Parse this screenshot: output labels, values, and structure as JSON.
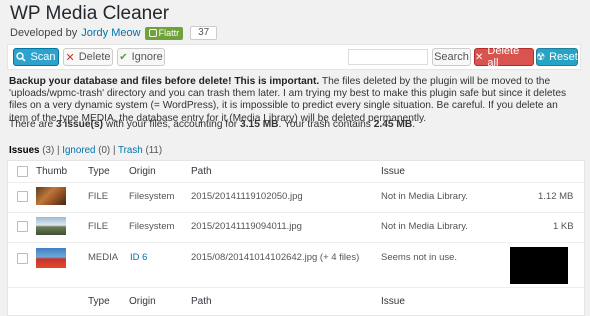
{
  "page": {
    "title": "WP Media Cleaner",
    "developed_by": "Developed by",
    "author": "Jordy Meow",
    "flattr_label": "Flattr",
    "flattr_count": "37"
  },
  "toolbar": {
    "scan_label": "Scan",
    "delete_label": "Delete",
    "ignore_label": "Ignore",
    "search_placeholder": "",
    "search_label": "Search",
    "delete_all_label": "Delete all",
    "reset_label": "Reset"
  },
  "notice": {
    "strong": "Backup your database and files before delete! This is important.",
    "text": " The files deleted by the plugin will be moved to the 'uploads/wpmc-trash' directory and you can trash them later. I am trying my best to make this plugin safe but since it deletes files on a very dynamic system (= WordPress), it is impossible to predict every single situation. Be careful. If you delete an item of the type MEDIA, the database entry for it (Media Library) will be deleted permanently."
  },
  "summary": {
    "prefix": "There are ",
    "issues": "3 issue(s)",
    "middle": " with your files, accounting for ",
    "size": "3.15 MB",
    "trash_text": ". Your trash contains ",
    "trash_size": "2.45 MB",
    "suffix": "."
  },
  "filters": {
    "issues_label": "Issues",
    "issues_count": "(3)",
    "sep1": "|",
    "ignored_label": "Ignored",
    "ignored_count": "(0)",
    "sep2": "|",
    "trash_label": "Trash",
    "trash_count": "(11)"
  },
  "table": {
    "columns": [
      "Thumb",
      "Type",
      "Origin",
      "Path",
      "Issue"
    ],
    "rows": [
      {
        "type": "FILE",
        "origin": "Filesystem",
        "path": "2015/20141119102050.jpg",
        "issue": "Not in Media Library.",
        "size": "1.12 MB"
      },
      {
        "type": "FILE",
        "origin": "Filesystem",
        "path": "2015/20141119094011.jpg",
        "issue": "Not in Media Library.",
        "size": "1 KB"
      },
      {
        "type": "MEDIA",
        "origin": "ID 6",
        "path": "2015/08/20141014102642.jpg (+ 4 files)",
        "issue": "Seems not in use.",
        "size": ""
      }
    ],
    "footer_columns": [
      "Type",
      "Origin",
      "Path",
      "Issue"
    ]
  },
  "colors": {
    "scan": "#2ea2cc",
    "delete_all": "#d9534f",
    "reset": "#27a3c6",
    "link": "#0073aa"
  }
}
